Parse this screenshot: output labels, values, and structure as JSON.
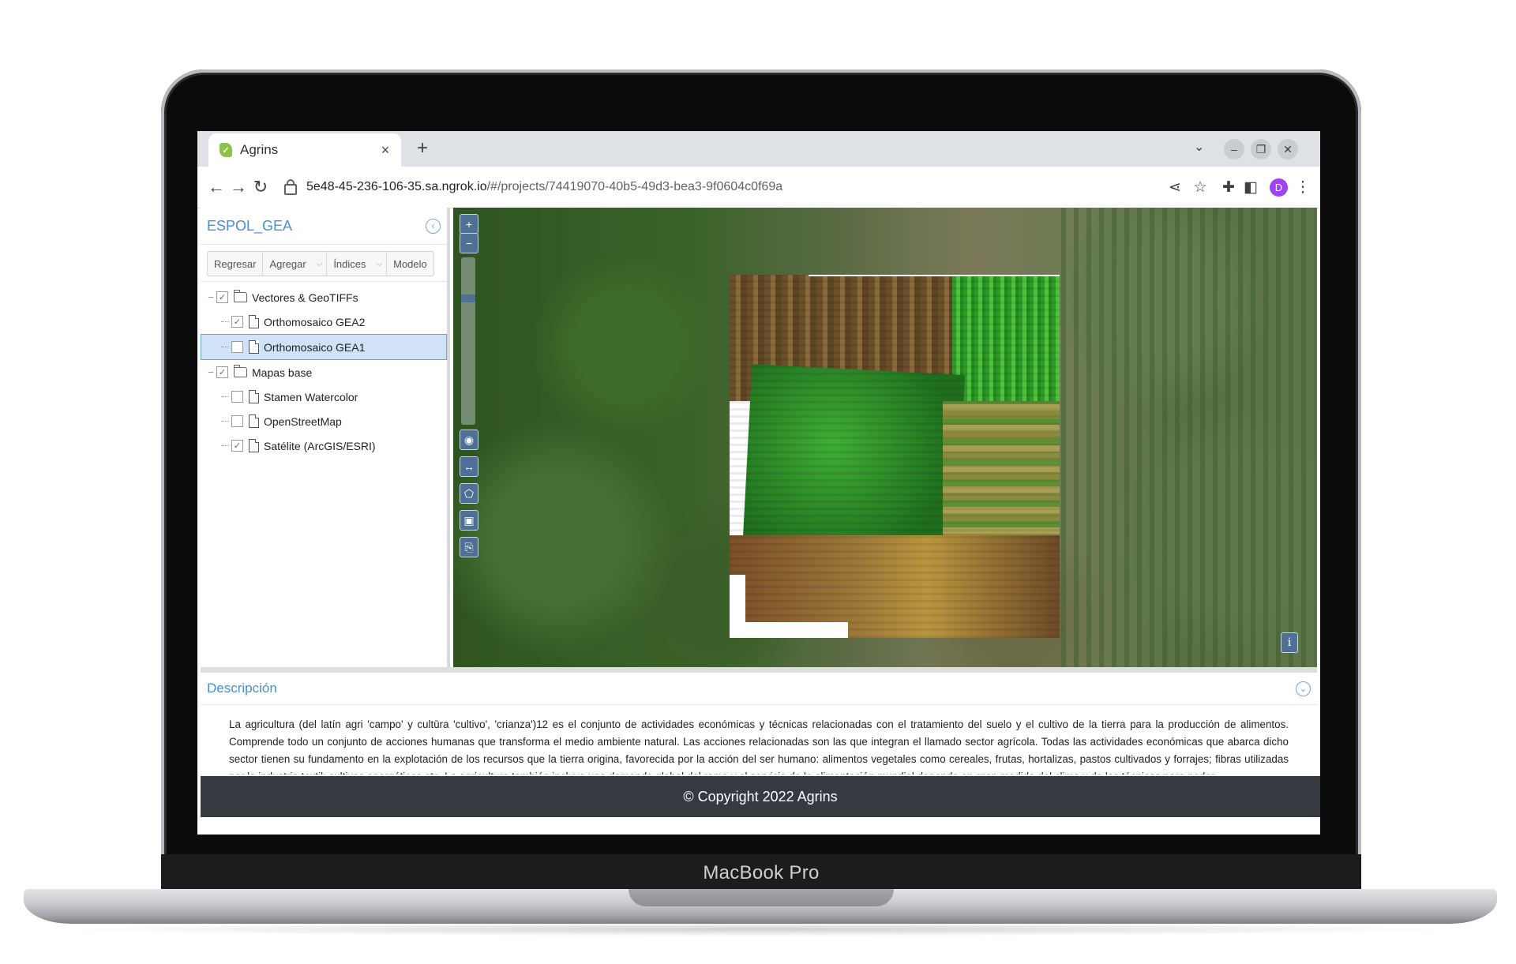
{
  "device": {
    "label": "MacBook Pro"
  },
  "browser": {
    "tab_title": "Agrins",
    "tab_close": "×",
    "new_tab": "+",
    "url_host": "5e48-45-236-106-35.sa.ngrok.io",
    "url_path": "/#/projects/74419070-40b5-49d3-bea3-9f0604c0f69a",
    "profile_initial": "D"
  },
  "panel": {
    "title": "ESPOL_GEA",
    "toolbar": {
      "back": "Regresar",
      "add": "Agregar",
      "indices": "Índices",
      "model": "Modelo"
    },
    "tree": [
      {
        "label": "Vectores & GeoTIFFs",
        "type": "folder",
        "checked": true,
        "level": 0
      },
      {
        "label": "Orthomosaico GEA2",
        "type": "file",
        "checked": true,
        "level": 1
      },
      {
        "label": "Orthomosaico GEA1",
        "type": "file",
        "checked": false,
        "level": 1,
        "selected": true
      },
      {
        "label": "Mapas base",
        "type": "folder",
        "checked": true,
        "level": 0
      },
      {
        "label": "Stamen Watercolor",
        "type": "file",
        "checked": false,
        "level": 1
      },
      {
        "label": "OpenStreetMap",
        "type": "file",
        "checked": false,
        "level": 1
      },
      {
        "label": "Satélite (ArcGIS/ESRI)",
        "type": "file",
        "checked": true,
        "level": 1
      }
    ]
  },
  "map": {
    "zoom_in": "+",
    "zoom_out": "−",
    "info": "i"
  },
  "description": {
    "title": "Descripción",
    "text": "La agricultura (del latín agri 'campo' y cultūra 'cultivo', 'crianza')12 es el conjunto de actividades económicas y técnicas relacionadas con el tratamiento del suelo y el cultivo de la tierra para la producción de alimentos. Comprende todo un conjunto de acciones humanas que transforma el medio ambiente natural. Las acciones relacionadas son las que integran el llamado sector agrícola. Todas las actividades económicas que abarca dicho sector tienen su fundamento en la explotación de los recursos que la tierra origina, favorecida por la acción del ser humano: alimentos vegetales como cereales, frutas, hortalizas, pastos cultivados y forrajes; fibras utilizadas por la industria textil; cultivos energéticos etc. La agricultura también incluye una demanda global del ramo y el servicio de la alimentación mundial depende en gran medida del clima y de las técnicas para poder"
  },
  "footer": {
    "text": "© Copyright 2022 Agrins"
  },
  "colors": {
    "accent": "#4a8fd1",
    "footer_bg": "#343a40",
    "map_control": "#4f6f95",
    "selected_row": "#cfe2f7"
  }
}
